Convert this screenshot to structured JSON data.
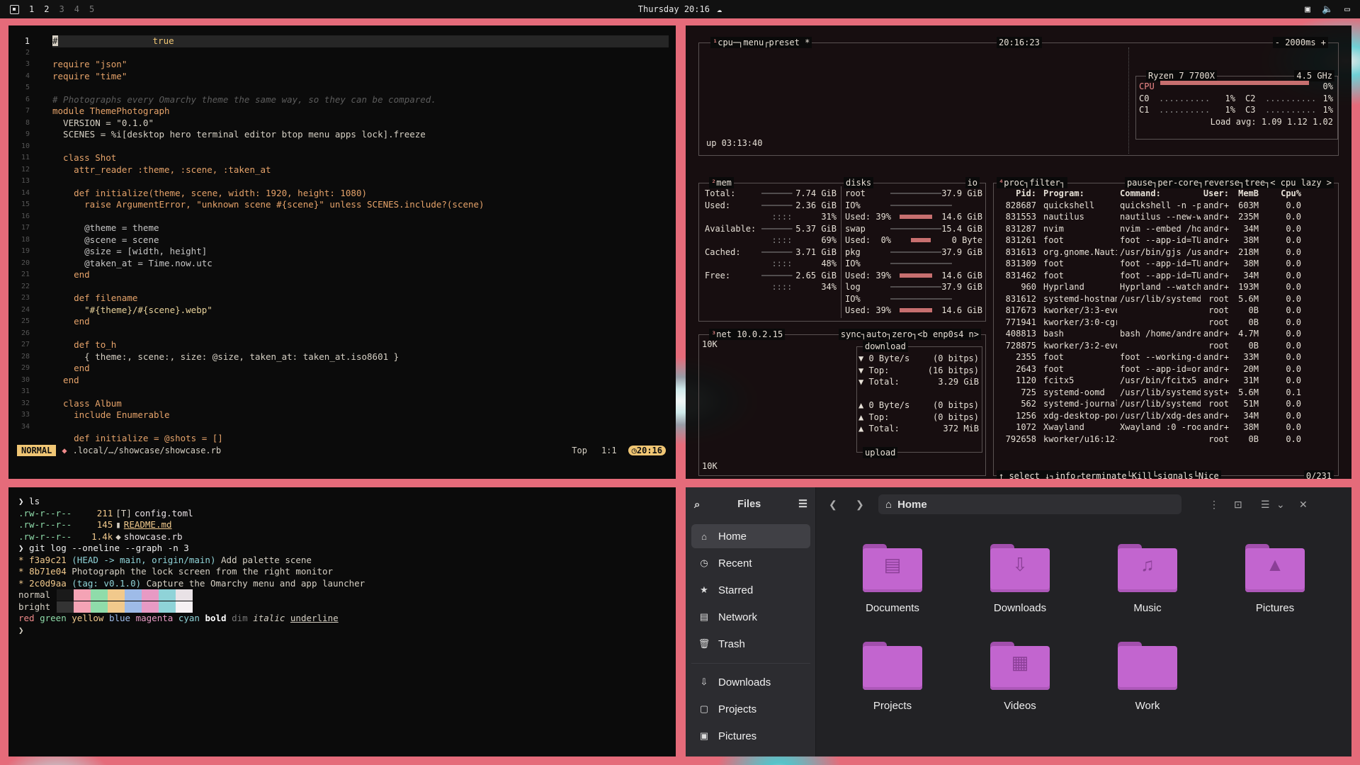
{
  "topbar": {
    "workspaces": [
      "1",
      "2",
      "3",
      "4",
      "5"
    ],
    "clock": "Thursday 20:16"
  },
  "nvim": {
    "line_numbers": [
      "1",
      "2",
      "3",
      "4",
      "5",
      "6",
      "7",
      "8",
      "9",
      "10",
      "11",
      "12",
      "13",
      "14",
      "15",
      "16",
      "17",
      "18",
      "19",
      "20",
      "21",
      "22",
      "23",
      "24",
      "25",
      "26",
      "27",
      "28",
      "29",
      "30",
      "31",
      "32",
      "33",
      "34"
    ],
    "virtual_text": "true",
    "cursor_char": "#",
    "code": [
      "",
      "",
      "require \"json\"",
      "require \"time\"",
      "",
      "# Photographs every Omarchy theme the same way, so they can be compared.",
      "module ThemePhotograph",
      "  VERSION = \"0.1.0\"",
      "  SCENES = %i[desktop hero terminal editor btop menu apps lock].freeze",
      "",
      "  class Shot",
      "    attr_reader :theme, :scene, :taken_at",
      "",
      "    def initialize(theme, scene, width: 1920, height: 1080)",
      "      raise ArgumentError, \"unknown scene #{scene}\" unless SCENES.include?(scene)",
      "",
      "      @theme = theme",
      "      @scene = scene",
      "      @size = [width, height]",
      "      @taken_at = Time.now.utc",
      "    end",
      "",
      "    def filename",
      "      \"#{theme}/#{scene}.webp\"",
      "    end",
      "",
      "    def to_h",
      "      { theme:, scene:, size: @size, taken_at: taken_at.iso8601 }",
      "    end",
      "  end",
      "",
      "  class Album",
      "    include Enumerable",
      "",
      "    def initialize = @shots = []"
    ],
    "status": {
      "mode": "NORMAL",
      "file": ".local/…/showcase/showcase.rb",
      "position": "Top",
      "cursor": "1:1",
      "time": "20:16"
    }
  },
  "btop": {
    "cpu": {
      "tabs": [
        "cpu",
        "menu",
        "preset *"
      ],
      "clock": "20:16:23",
      "interval": "- 2000ms +",
      "model": "Ryzen 7 7700X",
      "freq": "4.5 GHz",
      "uptime": "up 03:13:40",
      "load": "Load avg: 1.09 1.12 1.02",
      "cores": [
        {
          "name": "CPU",
          "pct": "0%"
        },
        {
          "name": "C0",
          "pct": "1%"
        },
        {
          "name": "C2",
          "pct": "1%"
        },
        {
          "name": "C1",
          "pct": "1%"
        },
        {
          "name": "C3",
          "pct": "1%"
        }
      ]
    },
    "mem": {
      "title": "mem",
      "rows": [
        {
          "k": "Total:",
          "v": "7.74 GiB"
        },
        {
          "k": "Used:",
          "v": "2.36 GiB"
        },
        {
          "k": "",
          "v": "31%"
        },
        {
          "k": "Available:",
          "v": "5.37 GiB"
        },
        {
          "k": "",
          "v": "69%"
        },
        {
          "k": "Cached:",
          "v": "3.71 GiB"
        },
        {
          "k": "",
          "v": "48%"
        },
        {
          "k": "Free:",
          "v": "2.65 GiB"
        },
        {
          "k": "",
          "v": "34%"
        }
      ]
    },
    "disks": {
      "title": "disks",
      "io": "io",
      "rows": [
        {
          "k": "root",
          "v": "37.9 GiB"
        },
        {
          "k": "IO%",
          "v": ""
        },
        {
          "k": "Used: 39%",
          "v": "14.6 GiB"
        },
        {
          "k": "swap",
          "v": "15.4 GiB"
        },
        {
          "k": "Used:  0%",
          "v": "0 Byte"
        },
        {
          "k": "pkg",
          "v": "37.9 GiB"
        },
        {
          "k": "IO%",
          "v": ""
        },
        {
          "k": "Used: 39%",
          "v": "14.6 GiB"
        },
        {
          "k": "log",
          "v": "37.9 GiB"
        },
        {
          "k": "IO%",
          "v": ""
        },
        {
          "k": "Used: 39%",
          "v": "14.6 GiB"
        }
      ]
    },
    "net": {
      "title": "net",
      "ip": "10.0.2.15",
      "opts": [
        "sync",
        "auto",
        "zero",
        "<b enp0s4 n>"
      ],
      "scale_top": "10K",
      "scale_bottom": "10K",
      "download_label": "download",
      "upload_label": "upload",
      "down": [
        {
          "k": "▼ 0 Byte/s",
          "v": "(0 bitps)"
        },
        {
          "k": "▼ Top:",
          "v": "(16 bitps)"
        },
        {
          "k": "▼ Total:",
          "v": "3.29 GiB"
        }
      ],
      "up": [
        {
          "k": "▲ 0 Byte/s",
          "v": "(0 bitps)"
        },
        {
          "k": "▲ Top:",
          "v": "(0 bitps)"
        },
        {
          "k": "▲ Total:",
          "v": "372 MiB"
        }
      ]
    },
    "proc": {
      "title": "proc",
      "header_opts": [
        "filter",
        "pause",
        "per-core",
        "reverse",
        "tree",
        "< cpu lazy >"
      ],
      "columns": [
        "Pid:",
        "Program:",
        "Command:",
        "User:",
        "MemB",
        "Cpu%"
      ],
      "rows": [
        [
          "828687",
          "quickshell",
          "quickshell -n -p /",
          "andr+",
          "603M",
          "0.0"
        ],
        [
          "831553",
          "nautilus",
          "nautilus --new-win",
          "andr+",
          "235M",
          "0.0"
        ],
        [
          "831287",
          "nvim",
          "nvim --embed /home",
          "andr+",
          "34M",
          "0.0"
        ],
        [
          "831261",
          "foot",
          "foot --app-id=TUI.",
          "andr+",
          "38M",
          "0.0"
        ],
        [
          "831613",
          "org.gnome.Nauti",
          "/usr/bin/gjs /usr/",
          "andr+",
          "218M",
          "0.0"
        ],
        [
          "831309",
          "foot",
          "foot --app-id=TUI.",
          "andr+",
          "38M",
          "0.0"
        ],
        [
          "831462",
          "foot",
          "foot --app-id=TUI.",
          "andr+",
          "34M",
          "0.0"
        ],
        [
          "960",
          "Hyprland",
          "Hyprland --watchdo",
          "andr+",
          "193M",
          "0.0"
        ],
        [
          "831612",
          "systemd-hostnam",
          "/usr/lib/systemd/s",
          "root",
          "5.6M",
          "0.0"
        ],
        [
          "817673",
          "kworker/3:3-even",
          "",
          "root",
          "0B",
          "0.0"
        ],
        [
          "771941",
          "kworker/3:0-cgro",
          "",
          "root",
          "0B",
          "0.0"
        ],
        [
          "408813",
          "bash",
          "bash /home/andreas",
          "andr+",
          "4.7M",
          "0.0"
        ],
        [
          "728875",
          "kworker/3:2-even",
          "",
          "root",
          "0B",
          "0.0"
        ],
        [
          "2355",
          "foot",
          "foot --working-dir",
          "andr+",
          "33M",
          "0.0"
        ],
        [
          "2643",
          "foot",
          "foot --app-id=org.",
          "andr+",
          "20M",
          "0.0"
        ],
        [
          "1120",
          "fcitx5",
          "/usr/bin/fcitx5 --",
          "andr+",
          "31M",
          "0.0"
        ],
        [
          "725",
          "systemd-oomd",
          "/usr/lib/systemd/s",
          "syst+",
          "5.6M",
          "0.1"
        ],
        [
          "562",
          "systemd-journal",
          "/usr/lib/systemd/s",
          "root",
          "51M",
          "0.0"
        ],
        [
          "1256",
          "xdg-desktop-por",
          "/usr/lib/xdg-deskt",
          "andr+",
          "34M",
          "0.0"
        ],
        [
          "1072",
          "Xwayland",
          "Xwayland :0 -rootl",
          "andr+",
          "38M",
          "0.0"
        ],
        [
          "792658",
          "kworker/u16:12-b",
          "",
          "root",
          "0B",
          "0.0"
        ]
      ],
      "footer": [
        "↑ select ↓",
        "info",
        "terminate",
        "Kill",
        "signals",
        "Nice"
      ],
      "count": "0/231"
    }
  },
  "terminal": {
    "lines": [
      {
        "t": "prompt",
        "text": "❯ ls"
      },
      {
        "t": "ls",
        "perm": ".rw-r--r--",
        "size": "211",
        "name": "config.toml",
        "icon": "[T]"
      },
      {
        "t": "ls",
        "perm": ".rw-r--r--",
        "size": "145",
        "name": "README.md",
        "icon": "▮"
      },
      {
        "t": "ls",
        "perm": ".rw-r--r--",
        "size": "1.4k",
        "name": "showcase.rb",
        "icon": "◆"
      },
      {
        "t": "prompt",
        "text": "❯ git log --oneline --graph -n 3"
      }
    ],
    "git": [
      {
        "hash": "f3a9c21",
        "ref": "(HEAD -> main, origin/main)",
        "msg": "Add palette scene"
      },
      {
        "hash": "8b71e04",
        "ref": "",
        "msg": "Photograph the lock screen from the right monitor"
      },
      {
        "hash": "2c0d9aa",
        "ref": "(tag: v0.1.0)",
        "msg": "Capture the Omarchy menu and app launcher"
      }
    ],
    "palette_labels": [
      "normal",
      "bright"
    ],
    "palette_normal": [
      "#1a1a1a",
      "#f4a3b5",
      "#8fdcaa",
      "#f1c98c",
      "#9ebbe8",
      "#e79ac4",
      "#8fd3d8",
      "#e9e2e6"
    ],
    "palette_bright": [
      "#333333",
      "#f4a3b5",
      "#8fdcaa",
      "#f1c98c",
      "#9ebbe8",
      "#e79ac4",
      "#8fd3d8",
      "#f6f1f3"
    ],
    "words": [
      "red",
      "green",
      "yellow",
      "blue",
      "magenta",
      "cyan",
      "bold",
      "dim",
      "italic",
      "underline"
    ],
    "word_colors": [
      "#f08a8a",
      "#8fdcaa",
      "#f1c98c",
      "#9ebbe8",
      "#e79ac4",
      "#8fd3d8"
    ],
    "final_prompt": "❯"
  },
  "files": {
    "title": "Files",
    "path": "Home",
    "sidebar": [
      {
        "label": "Home",
        "icon": "⌂"
      },
      {
        "label": "Recent",
        "icon": "◷"
      },
      {
        "label": "Starred",
        "icon": "★"
      },
      {
        "label": "Network",
        "icon": "▤"
      },
      {
        "label": "Trash",
        "icon": "🗑"
      }
    ],
    "bookmarks": [
      {
        "label": "Downloads",
        "icon": "⇩"
      },
      {
        "label": "Projects",
        "icon": "▢"
      },
      {
        "label": "Pictures",
        "icon": "▣"
      }
    ],
    "folders": [
      {
        "label": "Documents",
        "glyph": "▤"
      },
      {
        "label": "Downloads",
        "glyph": "⇩"
      },
      {
        "label": "Music",
        "glyph": "♫"
      },
      {
        "label": "Pictures",
        "glyph": "▲"
      },
      {
        "label": "Projects",
        "glyph": ""
      },
      {
        "label": "Videos",
        "glyph": "▦"
      },
      {
        "label": "Work",
        "glyph": ""
      }
    ]
  }
}
